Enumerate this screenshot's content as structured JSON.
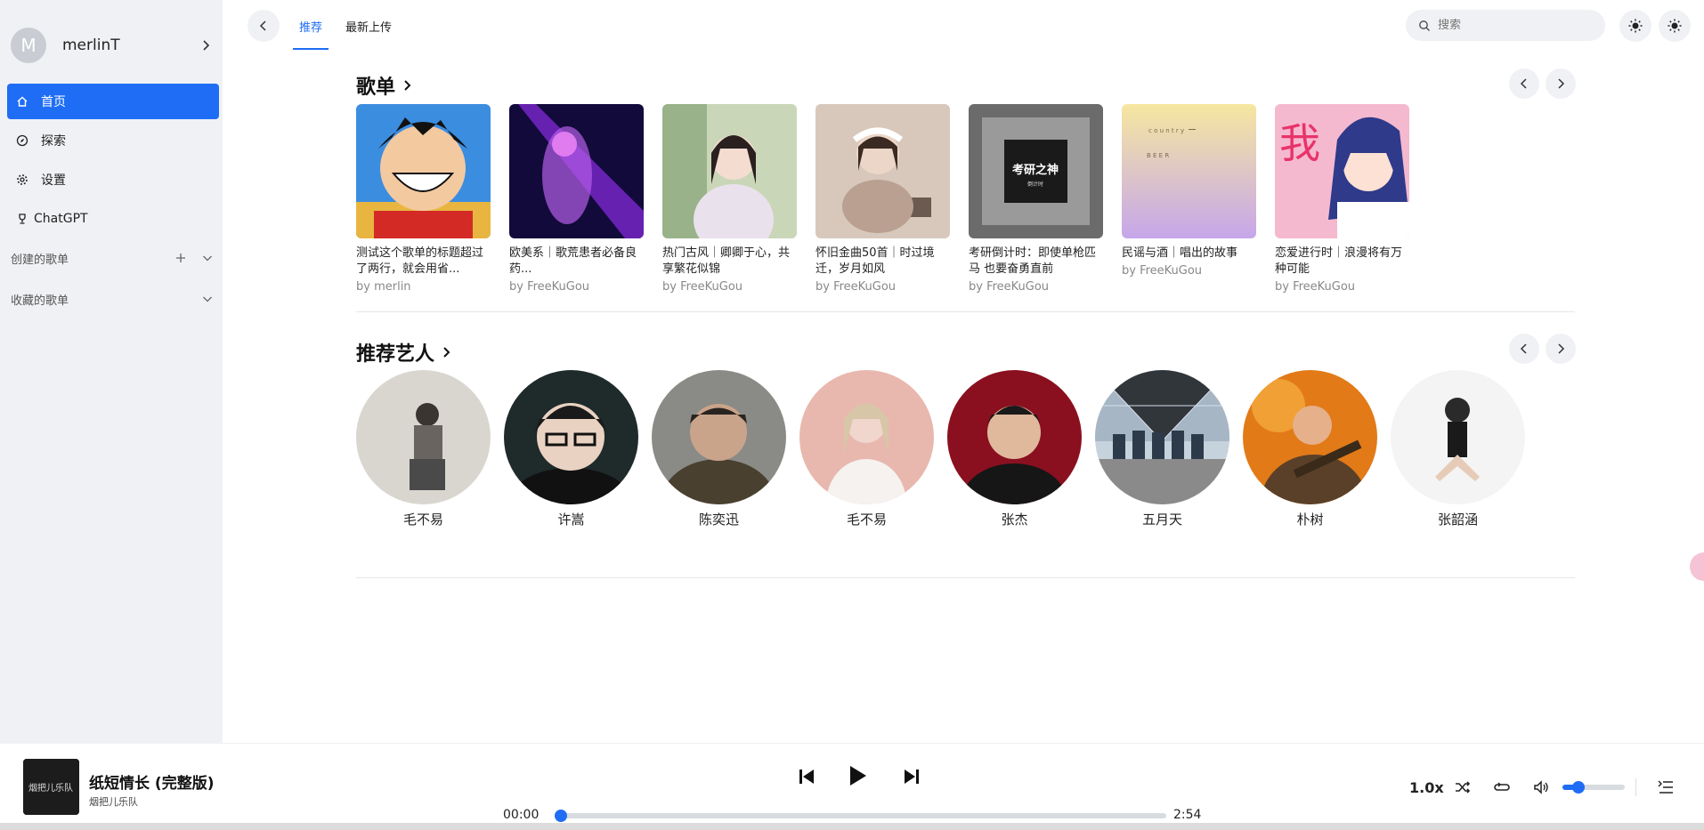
{
  "user": {
    "avatar_letter": "M",
    "name": "merlinT"
  },
  "nav": [
    {
      "label": "首页",
      "icon": "home-icon",
      "active": true
    },
    {
      "label": "探索",
      "icon": "compass-icon"
    },
    {
      "label": "设置",
      "icon": "gear-icon"
    },
    {
      "label": "ChatGPT",
      "icon": "trophy-icon"
    }
  ],
  "sections": {
    "created": "创建的歌单",
    "favorites": "收藏的歌单"
  },
  "tabs": [
    {
      "label": "推荐",
      "active": true
    },
    {
      "label": "最新上传"
    }
  ],
  "search": {
    "placeholder": "搜索"
  },
  "playlists_section": {
    "title": "歌单"
  },
  "playlists": [
    {
      "name": "测试这个歌单的标题超过了两行，就会用省...",
      "by": "by merlin"
    },
    {
      "name": "欧美系｜歌荒患者必备良药...",
      "by": "by FreeKuGou"
    },
    {
      "name": "热门古风｜卿卿于心，共享繁花似锦",
      "by": "by FreeKuGou"
    },
    {
      "name": "怀旧金曲50首｜时过境迁，岁月如风",
      "by": "by FreeKuGou"
    },
    {
      "name": "考研倒计时：即使单枪匹马 也要奋勇直前",
      "by": "by FreeKuGou"
    },
    {
      "name": "民谣与酒｜唱出的故事",
      "by": "by FreeKuGou"
    },
    {
      "name": "恋爱进行时｜浪漫将有万种可能",
      "by": "by FreeKuGou"
    }
  ],
  "artists_section": {
    "title": "推荐艺人"
  },
  "artists": [
    "毛不易",
    "许嵩",
    "陈奕迅",
    "毛不易",
    "张杰",
    "五月天",
    "朴树",
    "张韶涵"
  ],
  "player": {
    "title": "纸短情长 (完整版)",
    "artist": "烟把儿乐队",
    "current_time": "00:00",
    "total_time": "2:54",
    "speed": "1.0x",
    "progress": 0,
    "volume": 0.25
  },
  "colors": {
    "accent": "#1f6df5",
    "sidebar_bg": "#f0f1f4"
  }
}
